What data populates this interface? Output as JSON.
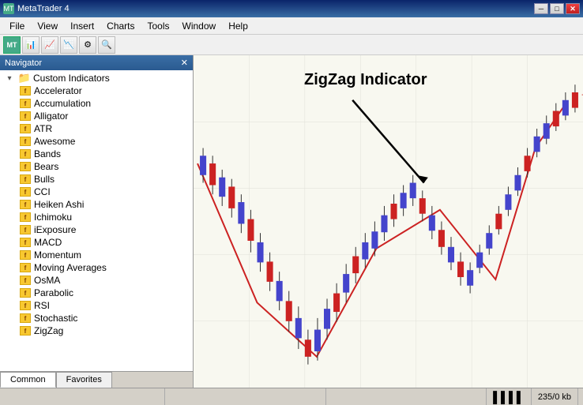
{
  "window": {
    "title": "MetaTrader 4",
    "controls": {
      "minimize": "─",
      "maximize": "□",
      "close": "✕"
    }
  },
  "menu": {
    "items": [
      "File",
      "View",
      "Insert",
      "Charts",
      "Tools",
      "Window",
      "Help"
    ]
  },
  "navigator": {
    "title": "Navigator",
    "close_btn": "✕",
    "sections": {
      "custom_indicators": {
        "label": "Custom Indicators",
        "items": [
          "Accelerator",
          "Accumulation",
          "Alligator",
          "ATR",
          "Awesome",
          "Bands",
          "Bears",
          "Bulls",
          "CCI",
          "Heiken Ashi",
          "Ichimoku",
          "iExposure",
          "MACD",
          "Momentum",
          "Moving Averages",
          "OsMA",
          "Parabolic",
          "RSI",
          "Stochastic",
          "ZigZag"
        ]
      }
    },
    "tabs": [
      "Common",
      "Favorites"
    ]
  },
  "chart": {
    "title": "ZigZag Indicator",
    "label": "ZigZag Indicator"
  },
  "status_bar": {
    "kb_label": "235/0 kb"
  }
}
